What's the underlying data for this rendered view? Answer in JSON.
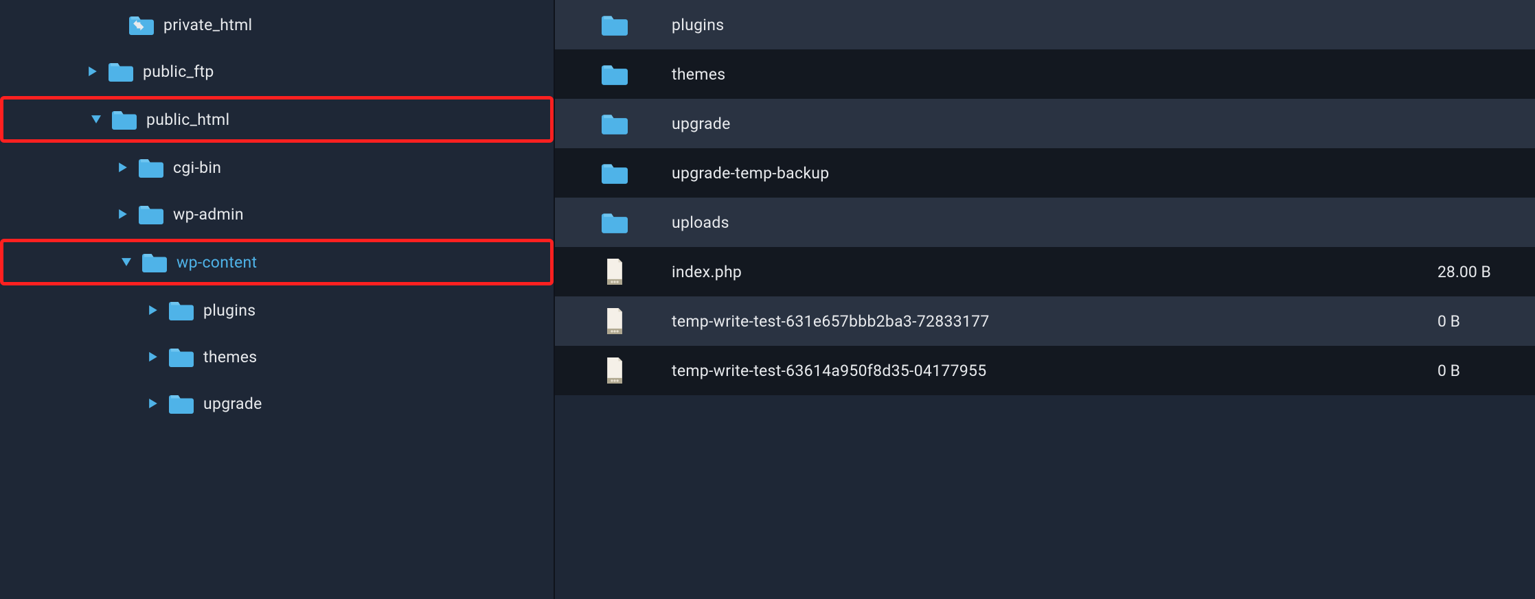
{
  "tree": [
    {
      "label": "private_html",
      "icon": "folder-link",
      "indent": 0,
      "chevron": "none",
      "active": false,
      "highlight": false
    },
    {
      "label": "public_ftp",
      "icon": "folder",
      "indent": 1,
      "chevron": "right",
      "active": false,
      "highlight": false
    },
    {
      "label": "public_html",
      "icon": "folder",
      "indent": 1,
      "chevron": "down",
      "active": false,
      "highlight": true
    },
    {
      "label": "cgi-bin",
      "icon": "folder",
      "indent": 2,
      "chevron": "right",
      "active": false,
      "highlight": false
    },
    {
      "label": "wp-admin",
      "icon": "folder",
      "indent": 2,
      "chevron": "right",
      "active": false,
      "highlight": false
    },
    {
      "label": "wp-content",
      "icon": "folder",
      "indent": 2,
      "chevron": "down",
      "active": true,
      "highlight": true
    },
    {
      "label": "plugins",
      "icon": "folder",
      "indent": 3,
      "chevron": "right",
      "active": false,
      "highlight": false
    },
    {
      "label": "themes",
      "icon": "folder",
      "indent": 3,
      "chevron": "right",
      "active": false,
      "highlight": false
    },
    {
      "label": "upgrade",
      "icon": "folder",
      "indent": 3,
      "chevron": "right",
      "active": false,
      "highlight": false
    }
  ],
  "list": [
    {
      "name": "plugins",
      "icon": "folder",
      "size": ""
    },
    {
      "name": "themes",
      "icon": "folder",
      "size": ""
    },
    {
      "name": "upgrade",
      "icon": "folder",
      "size": ""
    },
    {
      "name": "upgrade-temp-backup",
      "icon": "folder",
      "size": ""
    },
    {
      "name": "uploads",
      "icon": "folder",
      "size": ""
    },
    {
      "name": "index.php",
      "icon": "file",
      "size": "28.00 B"
    },
    {
      "name": "temp-write-test-631e657bbb2ba3-72833177",
      "icon": "file",
      "size": "0 B"
    },
    {
      "name": "temp-write-test-63614a950f8d35-04177955",
      "icon": "file",
      "size": "0 B"
    }
  ]
}
